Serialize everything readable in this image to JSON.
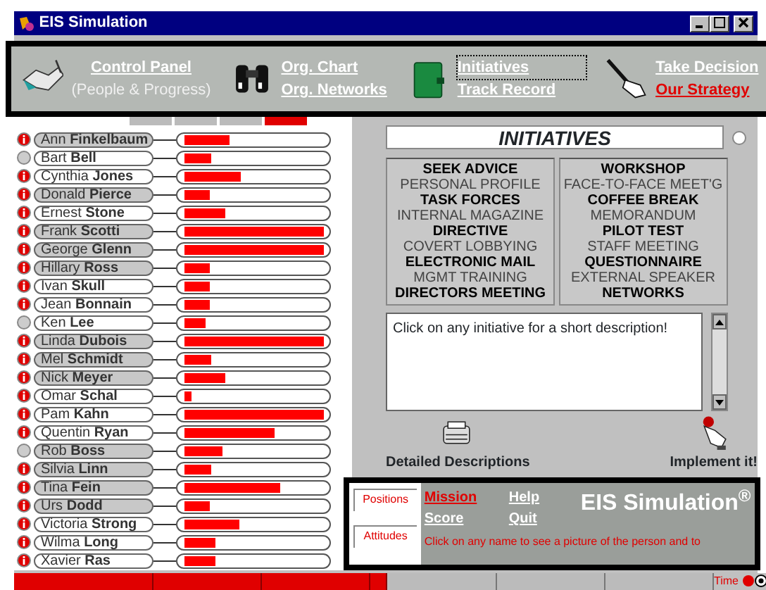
{
  "window": {
    "title": "EIS Simulation"
  },
  "toolbar": [
    {
      "links": [
        {
          "label": "Control Panel",
          "kind": "link",
          "highlighted": false,
          "focused": false
        },
        {
          "label": "(People & Progress)",
          "kind": "note"
        }
      ]
    },
    {
      "links": [
        {
          "label": "Org. Chart",
          "kind": "link",
          "highlighted": false,
          "focused": false
        },
        {
          "label": "Org. Networks",
          "kind": "link",
          "highlighted": false,
          "focused": false
        }
      ]
    },
    {
      "links": [
        {
          "label": "Initiatives",
          "kind": "link",
          "highlighted": false,
          "focused": true
        },
        {
          "label": "Track Record",
          "kind": "link",
          "highlighted": false,
          "focused": false
        }
      ]
    },
    {
      "links": [
        {
          "label": "Take Decision",
          "kind": "link",
          "highlighted": false,
          "focused": false
        },
        {
          "label": "Our Strategy",
          "kind": "link",
          "highlighted": true,
          "focused": false
        }
      ]
    }
  ],
  "people": [
    {
      "first": "Ann",
      "last": "Finkelbaum",
      "info": true,
      "highlighted": true,
      "level": 0.32
    },
    {
      "first": "Bart",
      "last": "Bell",
      "info": false,
      "highlighted": false,
      "level": 0.19
    },
    {
      "first": "Cynthia",
      "last": "Jones",
      "info": true,
      "highlighted": false,
      "level": 0.4
    },
    {
      "first": "Donald",
      "last": "Pierce",
      "info": true,
      "highlighted": true,
      "level": 0.18
    },
    {
      "first": "Ernest",
      "last": "Stone",
      "info": true,
      "highlighted": false,
      "level": 0.29
    },
    {
      "first": "Frank",
      "last": "Scotti",
      "info": true,
      "highlighted": true,
      "level": 1
    },
    {
      "first": "George",
      "last": "Glenn",
      "info": true,
      "highlighted": true,
      "level": 1
    },
    {
      "first": "Hillary",
      "last": "Ross",
      "info": true,
      "highlighted": true,
      "level": 0.18
    },
    {
      "first": "Ivan",
      "last": "Skull",
      "info": true,
      "highlighted": false,
      "level": 0.18
    },
    {
      "first": "Jean",
      "last": "Bonnain",
      "info": true,
      "highlighted": false,
      "level": 0.18
    },
    {
      "first": "Ken",
      "last": "Lee",
      "info": false,
      "highlighted": false,
      "level": 0.15
    },
    {
      "first": "Linda",
      "last": "Dubois",
      "info": true,
      "highlighted": true,
      "level": 1
    },
    {
      "first": "Mel",
      "last": "Schmidt",
      "info": true,
      "highlighted": true,
      "level": 0.19
    },
    {
      "first": "Nick",
      "last": "Meyer",
      "info": true,
      "highlighted": true,
      "level": 0.29
    },
    {
      "first": "Omar",
      "last": "Schal",
      "info": true,
      "highlighted": false,
      "level": 0.05
    },
    {
      "first": "Pam",
      "last": "Kahn",
      "info": true,
      "highlighted": false,
      "level": 1
    },
    {
      "first": "Quentin",
      "last": "Ryan",
      "info": true,
      "highlighted": false,
      "level": 0.65
    },
    {
      "first": "Rob",
      "last": "Boss",
      "info": false,
      "highlighted": true,
      "level": 0.27
    },
    {
      "first": "Silvia",
      "last": "Linn",
      "info": true,
      "highlighted": true,
      "level": 0.19
    },
    {
      "first": "Tina",
      "last": "Fein",
      "info": true,
      "highlighted": true,
      "level": 0.69
    },
    {
      "first": "Urs",
      "last": "Dodd",
      "info": true,
      "highlighted": true,
      "level": 0.18
    },
    {
      "first": "Victoria",
      "last": "Strong",
      "info": true,
      "highlighted": false,
      "level": 0.39
    },
    {
      "first": "Wilma",
      "last": "Long",
      "info": true,
      "highlighted": false,
      "level": 0.22
    },
    {
      "first": "Xavier",
      "last": "Ras",
      "info": true,
      "highlighted": false,
      "level": 0.22
    }
  ],
  "initiatives": {
    "title": "INITIATIVES",
    "radio": {
      "checked": false
    },
    "columns": [
      [
        {
          "label": "SEEK ADVICE",
          "available": true
        },
        {
          "label": "PERSONAL PROFILE",
          "available": false
        },
        {
          "label": "TASK FORCES",
          "available": true
        },
        {
          "label": "INTERNAL MAGAZINE",
          "available": false
        },
        {
          "label": "DIRECTIVE",
          "available": true
        },
        {
          "label": "COVERT LOBBYING",
          "available": false
        },
        {
          "label": "ELECTRONIC MAIL",
          "available": true
        },
        {
          "label": "MGMT TRAINING",
          "available": false
        },
        {
          "label": "DIRECTORS MEETING",
          "available": true
        }
      ],
      [
        {
          "label": "WORKSHOP",
          "available": true
        },
        {
          "label": "FACE-TO-FACE MEET'G",
          "available": false
        },
        {
          "label": "COFFEE BREAK",
          "available": true
        },
        {
          "label": "MEMORANDUM",
          "available": false
        },
        {
          "label": "PILOT TEST",
          "available": true
        },
        {
          "label": "STAFF MEETING",
          "available": false
        },
        {
          "label": "QUESTIONNAIRE",
          "available": true
        },
        {
          "label": "EXTERNAL SPEAKER",
          "available": false
        },
        {
          "label": "NETWORKS",
          "available": true
        }
      ]
    ],
    "description": "Click on any initiative for a short description!",
    "actions": [
      {
        "label": "Detailed Descriptions"
      },
      {
        "label": "Implement it!"
      }
    ]
  },
  "bottom": {
    "views": [
      {
        "label": "Positions",
        "selected": false
      },
      {
        "label": "Attitudes",
        "selected": false
      }
    ],
    "links": [
      {
        "label": "Mission",
        "highlighted": true
      },
      {
        "label": "Help",
        "highlighted": false
      },
      {
        "label": "Score",
        "highlighted": false
      },
      {
        "label": "Quit",
        "highlighted": false
      }
    ],
    "brand": "EIS Simulation",
    "brand_mark": "®",
    "hint": "Click on any name to see a picture of the person and to"
  },
  "status_bar": {
    "time_label": "Time"
  }
}
